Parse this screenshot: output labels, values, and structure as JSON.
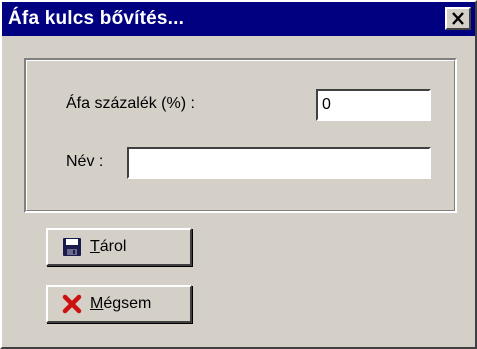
{
  "window": {
    "title": "Áfa kulcs bővítés...",
    "close_icon": "close-icon",
    "colors": {
      "titlebar": "#000080",
      "face": "#d4d0c8",
      "title_text": "#ffffff"
    }
  },
  "form": {
    "vat_label": "Áfa százalék (%) :",
    "vat_value": "0",
    "name_label": "Név :",
    "name_value": ""
  },
  "buttons": {
    "save": {
      "mnemonic": "T",
      "rest": "árol",
      "icon": "floppy-disk-icon"
    },
    "cancel": {
      "mnemonic": "M",
      "rest": "égsem",
      "icon": "red-x-icon"
    }
  }
}
